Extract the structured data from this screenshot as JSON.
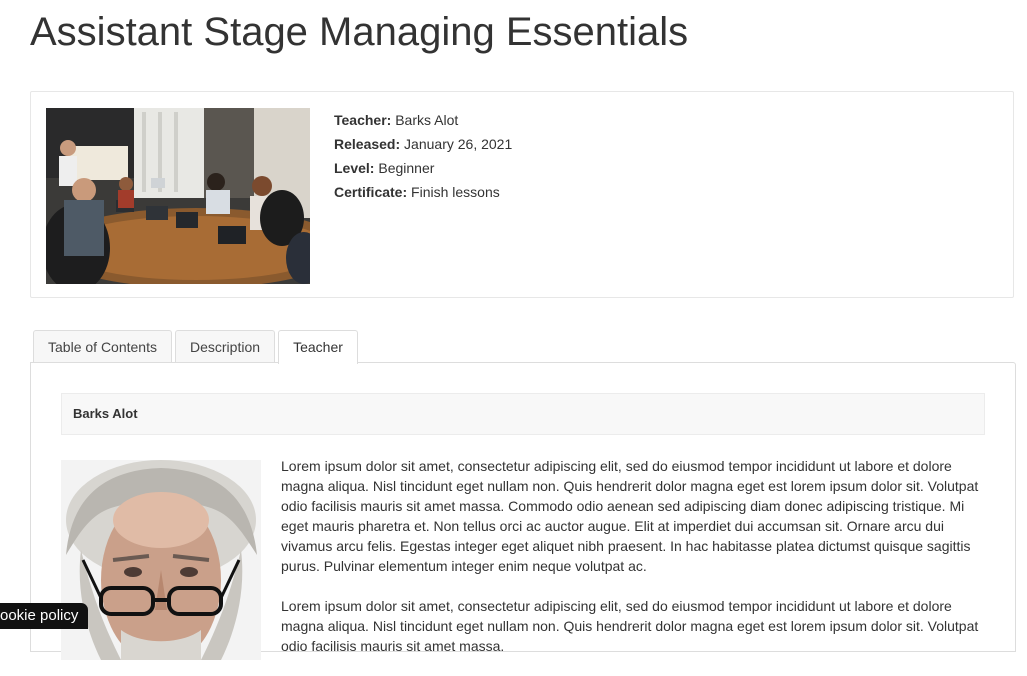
{
  "course": {
    "title": "Assistant Stage Managing Essentials",
    "meta": [
      {
        "label": "Teacher:",
        "value": "Barks Alot"
      },
      {
        "label": "Released:",
        "value": "January 26, 2021"
      },
      {
        "label": "Level:",
        "value": "Beginner"
      },
      {
        "label": "Certificate:",
        "value": "Finish lessons"
      }
    ]
  },
  "tabs": [
    {
      "label": "Table of Contents"
    },
    {
      "label": "Description"
    },
    {
      "label": "Teacher"
    }
  ],
  "teacher": {
    "name": "Barks Alot",
    "bio": [
      "Lorem ipsum dolor sit amet, consectetur adipiscing elit, sed do eiusmod tempor incididunt ut labore et dolore magna aliqua. Nisl tincidunt eget nullam non. Quis hendrerit dolor magna eget est lorem ipsum dolor sit. Volutpat odio facilisis mauris sit amet massa. Commodo odio aenean sed adipiscing diam donec adipiscing tristique. Mi eget mauris pharetra et. Non tellus orci ac auctor augue. Elit at imperdiet dui accumsan sit. Ornare arcu dui vivamus arcu felis. Egestas integer eget aliquet nibh praesent. In hac habitasse platea dictumst quisque sagittis purus. Pulvinar elementum integer enim neque volutpat ac.",
      "Lorem ipsum dolor sit amet, consectetur adipiscing elit, sed do eiusmod tempor incididunt ut labore et dolore magna aliqua. Nisl tincidunt eget nullam non. Quis hendrerit dolor magna eget est lorem ipsum dolor sit. Volutpat odio facilisis mauris sit amet massa."
    ]
  },
  "cookie": {
    "label": "ookie policy"
  }
}
